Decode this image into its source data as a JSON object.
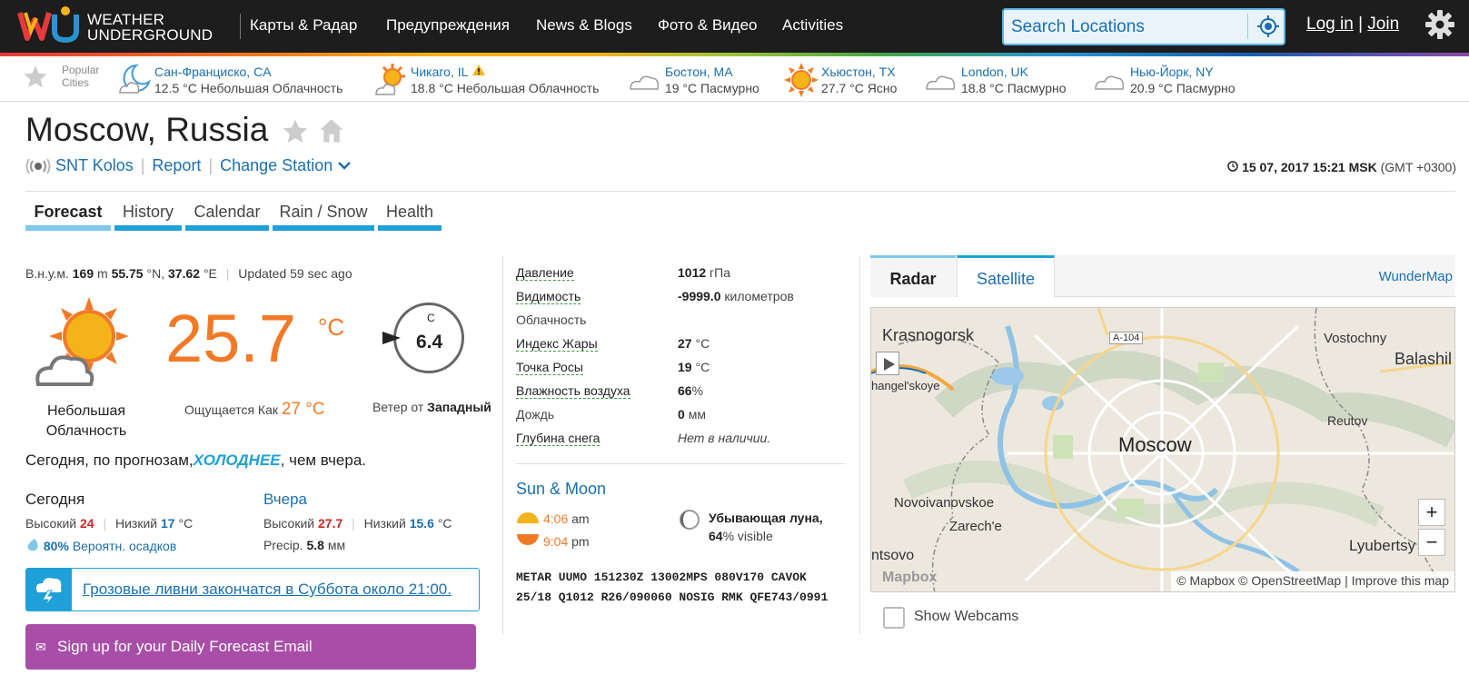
{
  "header": {
    "logo_line1": "WEATHER",
    "logo_line2": "UNDERGROUND",
    "nav": [
      "Карты & Радар",
      "Предупреждения",
      "News & Blogs",
      "Фото & Видео",
      "Activities"
    ],
    "search_placeholder": "Search Locations",
    "login": "Log in",
    "join": "Join"
  },
  "popular": {
    "label_line1": "Popular",
    "label_line2": "Cities",
    "cities": [
      {
        "name": "Сан-Франциско, CA",
        "desc": "12.5 °C Небольшая Облачность",
        "icon": "moon-cloud-icon"
      },
      {
        "name": "Чикаго, IL",
        "desc": "18.8 °C Небольшая Облачность",
        "icon": "sun-cloud-icon"
      },
      {
        "name": "Бостон, MA",
        "desc": "19 °C Пасмурно",
        "icon": "cloud-icon"
      },
      {
        "name": "Хьюстон, TX",
        "desc": "27.7 °C Ясно",
        "icon": "sun-icon"
      },
      {
        "name": "London, UK",
        "desc": "18.8 °C Пасмурно",
        "icon": "cloud-icon"
      },
      {
        "name": "Нью-Йорк, NY",
        "desc": "20.9 °C Пасмурно",
        "icon": "cloud-icon"
      }
    ]
  },
  "location": {
    "title": "Moscow, Russia",
    "station": "SNT Kolos",
    "report": "Report",
    "change_station": "Change Station",
    "datetime": "15 07, 2017 15:21 MSK",
    "gmt": "(GMT +0300)"
  },
  "tabs": [
    "Forecast",
    "History",
    "Calendar",
    "Rain / Snow",
    "Health"
  ],
  "current": {
    "elev_label": "В.н.у.м.",
    "elev_value": "169",
    "elev_unit": "m",
    "lat": "55.75",
    "lat_unit": "°N,",
    "lon": "37.62",
    "lon_unit": "°E",
    "updated": "Updated 59 sec ago",
    "temp": "25.7",
    "temp_unit": "°C",
    "condition_line1": "Небольшая",
    "condition_line2": "Облачность",
    "feels_label": "Ощущается Как",
    "feels_value": "27 °C",
    "wind_unit_letter": "C",
    "wind_value": "6.4",
    "wind_label": "Ветер от",
    "wind_dir": "Западный",
    "forecast_pre": "Сегодня, по прогнозам,",
    "forecast_em": "ХОЛОДНЕЕ",
    "forecast_post": ", чем вчера."
  },
  "today": {
    "title": "Сегодня",
    "high_label": "Высокий",
    "high": "24",
    "low_label": "Низкий",
    "low": "17",
    "unit": "°C",
    "precip_pct": "80%",
    "precip_label": "Вероятн. осадков"
  },
  "yesterday": {
    "title": "Вчера",
    "high_label": "Высокий",
    "high": "27.7",
    "low_label": "Низкий",
    "low": "15.6",
    "unit": "°C",
    "precip_label": "Precip.",
    "precip_value": "5.8",
    "precip_unit": "мм"
  },
  "alert": {
    "text": "Грозовые ливни закончатся в Суббота около 21:00."
  },
  "email": {
    "text": "Sign up for your Daily Forecast Email"
  },
  "conditions": [
    {
      "label": "Давление",
      "value": "1012",
      "unit": "гПа"
    },
    {
      "label": "Видимость",
      "value": "-9999.0",
      "unit": "километров"
    },
    {
      "label": "Облачность",
      "value": "",
      "unit": ""
    },
    {
      "label": "Индекс Жары",
      "value": "27",
      "unit": "°C"
    },
    {
      "label": "Точка Росы",
      "value": "19",
      "unit": "°C"
    },
    {
      "label": "Влажность воздуха",
      "value": "66",
      "unit": "%"
    },
    {
      "label": "Дождь",
      "value": "0",
      "unit": "мм"
    },
    {
      "label": "Глубина снега",
      "value": "",
      "unit": "Нет в наличии."
    }
  ],
  "sunmoon": {
    "title": "Sun & Moon",
    "sunrise": "4:06",
    "sunrise_ampm": "am",
    "sunset": "9:04",
    "sunset_ampm": "pm",
    "moon_phase": "Убывающая луна,",
    "moon_visible": "64",
    "moon_visible_label": "% visible"
  },
  "metar": "METAR UUMO 151230Z 13002MPS 080V170 CAVOK 25/18 Q1012 R26/090060 NOSIG RMK QFE743/0991",
  "map": {
    "tabs": [
      "Radar",
      "Satellite"
    ],
    "wundermap": "WunderMap",
    "labels": {
      "krasnogorsk": "Krasnogorsk",
      "vostochny": "Vostochny",
      "balashikha": "Balashil",
      "a104": "A-104",
      "arkhangelskoye": "hangel'skoye",
      "moscow": "Moscow",
      "reutov": "Reutov",
      "novoivanovskoe": "Novoivanovskoe",
      "zareche": "Zarech'e",
      "lyubertsy": "Lyubertsy",
      "sovo": "ntsovo"
    },
    "zoom_in": "+",
    "zoom_out": "−",
    "mapbox": "Mapbox",
    "attribution": "© Mapbox © OpenStreetMap | Improve this map",
    "show_webcams": "Show Webcams"
  },
  "colors": {
    "accent_blue": "#1fa0d8",
    "temp_orange": "#f27a27",
    "email_purple": "#a84ea8"
  }
}
